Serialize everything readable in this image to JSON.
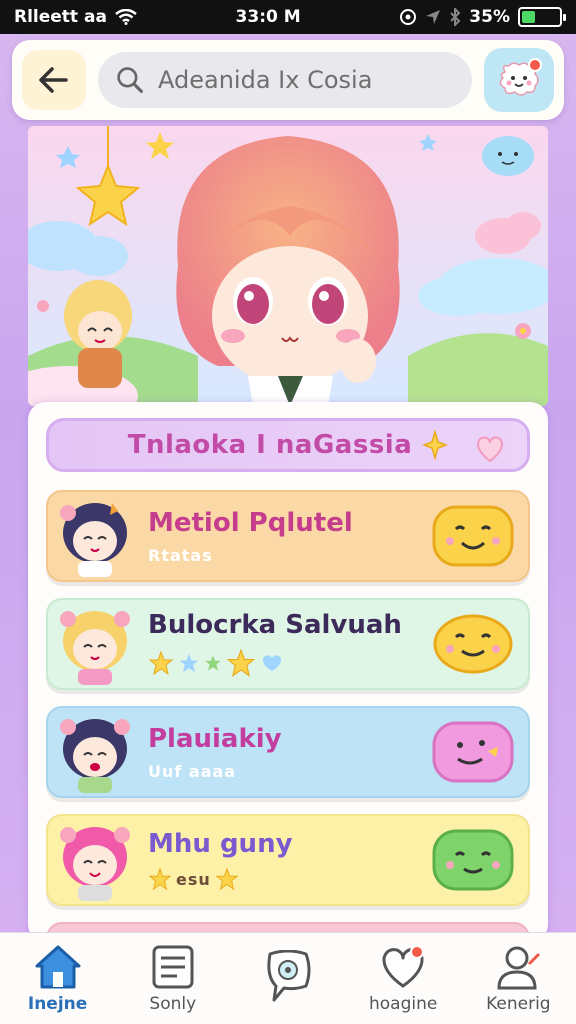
{
  "status": {
    "carrier": "Rlleett aa",
    "time": "33:0 M",
    "battery_text": "35%",
    "battery_level": 0.35,
    "battery_color": "#4cd964"
  },
  "topbar": {
    "back_icon": "arrow-left",
    "search_placeholder": "Adeanida Ix Cosia",
    "avatar_icon": "chat-bubble-face"
  },
  "hero": {
    "image": "anime-girl-waving-with-friends-and-stars"
  },
  "list": {
    "header_title": "Tnlaoka I naGassia",
    "items": [
      {
        "name": "Metiol Pqlutel",
        "sub": "Rtatas",
        "bg": "#fbd9a6",
        "emoji_color": "#fbd34a"
      },
      {
        "name": "Bulocrka Salvuah",
        "sub": "",
        "bg": "#dff5e6",
        "emoji_color": "#fbd34a"
      },
      {
        "name": "Plauiakiy",
        "sub": "Uuf aaaa",
        "bg": "#bfe3f6",
        "emoji_color": "#f29ae0"
      },
      {
        "name": "Mhu guny",
        "sub": "esu",
        "bg": "#fdf1a8",
        "emoji_color": "#7ed36a"
      }
    ]
  },
  "nav": {
    "items": [
      {
        "label": "Inejne",
        "icon": "home-icon",
        "active": true
      },
      {
        "label": "Sonly",
        "icon": "news-icon",
        "active": false
      },
      {
        "label": "",
        "icon": "chat-icon",
        "active": false
      },
      {
        "label": "hoagine",
        "icon": "heart-icon",
        "active": false
      },
      {
        "label": "Kenerig",
        "icon": "profile-icon",
        "active": false
      }
    ]
  }
}
